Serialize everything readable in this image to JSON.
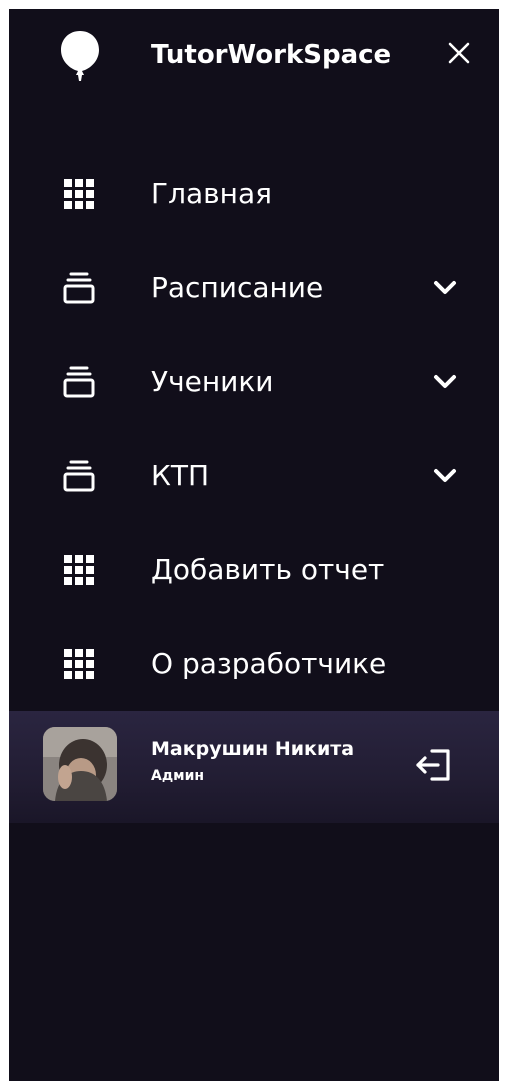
{
  "app": {
    "title": "TutorWorkSpace",
    "logo_icon": "balloon-icon",
    "close_icon": "close-icon"
  },
  "nav": {
    "items": [
      {
        "label": "Главная",
        "icon": "grid-icon",
        "has_chevron": false
      },
      {
        "label": "Расписание",
        "icon": "stack-icon",
        "has_chevron": true
      },
      {
        "label": "Ученики",
        "icon": "stack-icon",
        "has_chevron": true
      },
      {
        "label": "КТП",
        "icon": "stack-icon",
        "has_chevron": true
      },
      {
        "label": "Добавить отчет",
        "icon": "grid-icon",
        "has_chevron": false
      },
      {
        "label": "О разработчике",
        "icon": "grid-icon",
        "has_chevron": false
      }
    ]
  },
  "user": {
    "name": "Макрушин Никита",
    "role": "Админ",
    "logout_icon": "logout-icon"
  },
  "colors": {
    "sidebar_bg": "#110e1a",
    "user_card_bg": "#2a2540",
    "text": "#ffffff"
  }
}
